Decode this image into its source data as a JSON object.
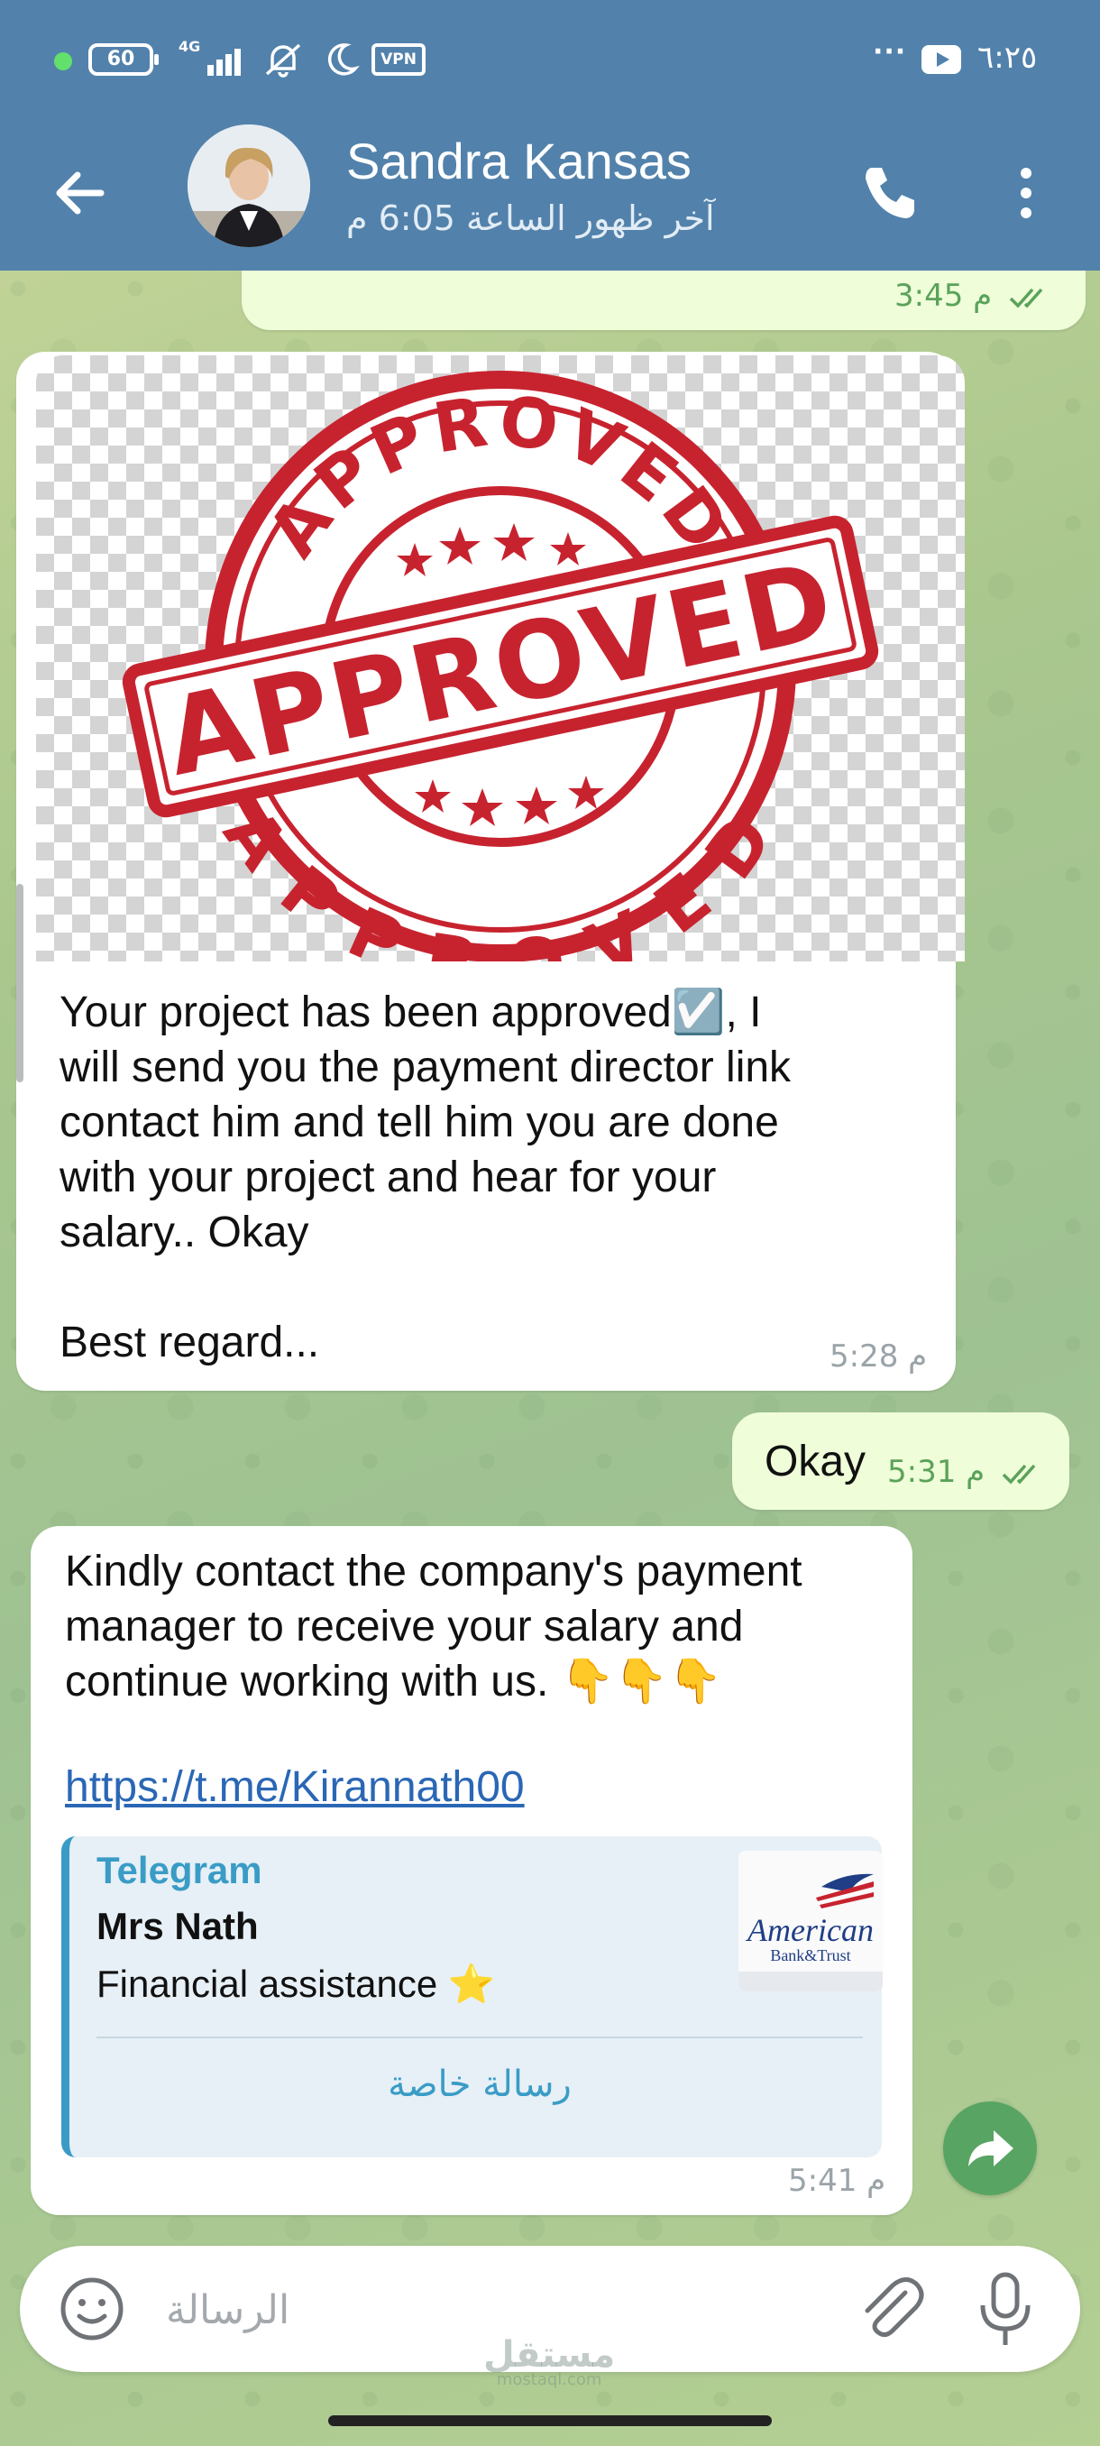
{
  "status_bar": {
    "battery": "60",
    "network": "4G",
    "vpn": "VPN",
    "more": "···",
    "time": "٦:٢٥"
  },
  "header": {
    "contact_name": "Sandra Kansas",
    "last_seen": "آخر ظهور الساعة 6:05 م"
  },
  "messages": [
    {
      "direction": "out",
      "time": "3:45 م",
      "read": true
    },
    {
      "direction": "in",
      "image": {
        "stamp_text": "APPROVED"
      },
      "text": "Your project has been approved☑️, I\nwill send you the payment director link\ncontact him and tell him you are done\nwith your project and hear for your\nsalary.. Okay\n\nBest regard...",
      "time": "5:28 م"
    },
    {
      "direction": "out",
      "text": "Okay",
      "time": "5:31 م",
      "read": true
    },
    {
      "direction": "in",
      "text": "Kindly contact the company's payment\nmanager to receive your salary and\ncontinue working with us. 👇👇👇",
      "link": "https://t.me/Kirannath00",
      "preview": {
        "site": "Telegram",
        "title": "Mrs Nath",
        "description": "Financial assistance ⭐",
        "thumb_text_1": "American",
        "thumb_text_2": "Bank&Trust",
        "action": "رسالة خاصة"
      },
      "time": "5:41 م"
    }
  ],
  "composer": {
    "placeholder": "الرسالة"
  },
  "watermark": {
    "line1": "مستقل",
    "line2": "mostaql.com"
  },
  "colors": {
    "header_bg": "#5282ab",
    "outgoing_bubble": "#effed9",
    "accent": "#3a9cc6",
    "stamp_red": "#c7232f",
    "share_button": "#58a463"
  },
  "icons": [
    "back-arrow-icon",
    "phone-icon",
    "more-vertical-icon",
    "double-check-icon",
    "share-icon",
    "emoji-icon",
    "attach-icon",
    "mic-icon"
  ]
}
